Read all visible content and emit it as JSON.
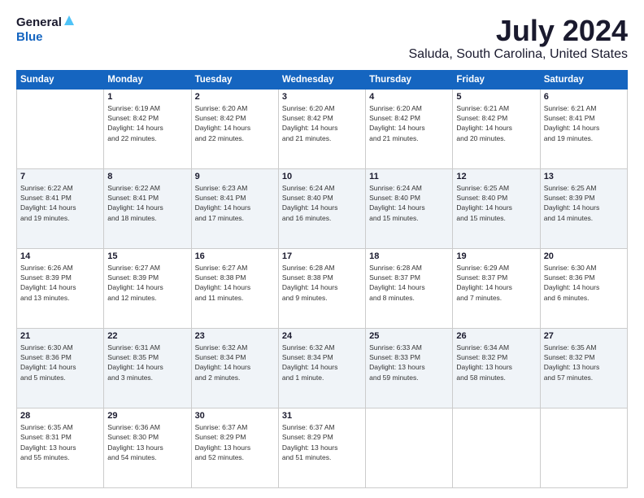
{
  "header": {
    "logo_general": "General",
    "logo_blue": "Blue",
    "month_title": "July 2024",
    "location": "Saluda, South Carolina, United States"
  },
  "columns": [
    "Sunday",
    "Monday",
    "Tuesday",
    "Wednesday",
    "Thursday",
    "Friday",
    "Saturday"
  ],
  "weeks": [
    [
      {
        "day": "",
        "info": ""
      },
      {
        "day": "1",
        "info": "Sunrise: 6:19 AM\nSunset: 8:42 PM\nDaylight: 14 hours\nand 22 minutes."
      },
      {
        "day": "2",
        "info": "Sunrise: 6:20 AM\nSunset: 8:42 PM\nDaylight: 14 hours\nand 22 minutes."
      },
      {
        "day": "3",
        "info": "Sunrise: 6:20 AM\nSunset: 8:42 PM\nDaylight: 14 hours\nand 21 minutes."
      },
      {
        "day": "4",
        "info": "Sunrise: 6:20 AM\nSunset: 8:42 PM\nDaylight: 14 hours\nand 21 minutes."
      },
      {
        "day": "5",
        "info": "Sunrise: 6:21 AM\nSunset: 8:42 PM\nDaylight: 14 hours\nand 20 minutes."
      },
      {
        "day": "6",
        "info": "Sunrise: 6:21 AM\nSunset: 8:41 PM\nDaylight: 14 hours\nand 19 minutes."
      }
    ],
    [
      {
        "day": "7",
        "info": "Sunrise: 6:22 AM\nSunset: 8:41 PM\nDaylight: 14 hours\nand 19 minutes."
      },
      {
        "day": "8",
        "info": "Sunrise: 6:22 AM\nSunset: 8:41 PM\nDaylight: 14 hours\nand 18 minutes."
      },
      {
        "day": "9",
        "info": "Sunrise: 6:23 AM\nSunset: 8:41 PM\nDaylight: 14 hours\nand 17 minutes."
      },
      {
        "day": "10",
        "info": "Sunrise: 6:24 AM\nSunset: 8:40 PM\nDaylight: 14 hours\nand 16 minutes."
      },
      {
        "day": "11",
        "info": "Sunrise: 6:24 AM\nSunset: 8:40 PM\nDaylight: 14 hours\nand 15 minutes."
      },
      {
        "day": "12",
        "info": "Sunrise: 6:25 AM\nSunset: 8:40 PM\nDaylight: 14 hours\nand 15 minutes."
      },
      {
        "day": "13",
        "info": "Sunrise: 6:25 AM\nSunset: 8:39 PM\nDaylight: 14 hours\nand 14 minutes."
      }
    ],
    [
      {
        "day": "14",
        "info": "Sunrise: 6:26 AM\nSunset: 8:39 PM\nDaylight: 14 hours\nand 13 minutes."
      },
      {
        "day": "15",
        "info": "Sunrise: 6:27 AM\nSunset: 8:39 PM\nDaylight: 14 hours\nand 12 minutes."
      },
      {
        "day": "16",
        "info": "Sunrise: 6:27 AM\nSunset: 8:38 PM\nDaylight: 14 hours\nand 11 minutes."
      },
      {
        "day": "17",
        "info": "Sunrise: 6:28 AM\nSunset: 8:38 PM\nDaylight: 14 hours\nand 9 minutes."
      },
      {
        "day": "18",
        "info": "Sunrise: 6:28 AM\nSunset: 8:37 PM\nDaylight: 14 hours\nand 8 minutes."
      },
      {
        "day": "19",
        "info": "Sunrise: 6:29 AM\nSunset: 8:37 PM\nDaylight: 14 hours\nand 7 minutes."
      },
      {
        "day": "20",
        "info": "Sunrise: 6:30 AM\nSunset: 8:36 PM\nDaylight: 14 hours\nand 6 minutes."
      }
    ],
    [
      {
        "day": "21",
        "info": "Sunrise: 6:30 AM\nSunset: 8:36 PM\nDaylight: 14 hours\nand 5 minutes."
      },
      {
        "day": "22",
        "info": "Sunrise: 6:31 AM\nSunset: 8:35 PM\nDaylight: 14 hours\nand 3 minutes."
      },
      {
        "day": "23",
        "info": "Sunrise: 6:32 AM\nSunset: 8:34 PM\nDaylight: 14 hours\nand 2 minutes."
      },
      {
        "day": "24",
        "info": "Sunrise: 6:32 AM\nSunset: 8:34 PM\nDaylight: 14 hours\nand 1 minute."
      },
      {
        "day": "25",
        "info": "Sunrise: 6:33 AM\nSunset: 8:33 PM\nDaylight: 13 hours\nand 59 minutes."
      },
      {
        "day": "26",
        "info": "Sunrise: 6:34 AM\nSunset: 8:32 PM\nDaylight: 13 hours\nand 58 minutes."
      },
      {
        "day": "27",
        "info": "Sunrise: 6:35 AM\nSunset: 8:32 PM\nDaylight: 13 hours\nand 57 minutes."
      }
    ],
    [
      {
        "day": "28",
        "info": "Sunrise: 6:35 AM\nSunset: 8:31 PM\nDaylight: 13 hours\nand 55 minutes."
      },
      {
        "day": "29",
        "info": "Sunrise: 6:36 AM\nSunset: 8:30 PM\nDaylight: 13 hours\nand 54 minutes."
      },
      {
        "day": "30",
        "info": "Sunrise: 6:37 AM\nSunset: 8:29 PM\nDaylight: 13 hours\nand 52 minutes."
      },
      {
        "day": "31",
        "info": "Sunrise: 6:37 AM\nSunset: 8:29 PM\nDaylight: 13 hours\nand 51 minutes."
      },
      {
        "day": "",
        "info": ""
      },
      {
        "day": "",
        "info": ""
      },
      {
        "day": "",
        "info": ""
      }
    ]
  ]
}
